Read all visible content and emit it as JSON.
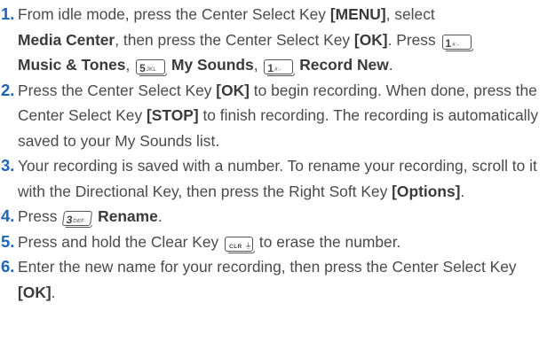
{
  "steps": [
    {
      "num": "1.",
      "t1": "From idle mode, press the Center Select Key ",
      "b1": "[MENU]",
      "t2": ", select ",
      "b2": "Media Center",
      "t3": ", then press the Center Select Key ",
      "b3": "[OK]",
      "t4": ". Press ",
      "key1": {
        "digit": "1",
        "letters": "#:-",
        "icon": "key-1-icon"
      },
      "b4": "Music & Tones",
      "t5": ", ",
      "key2": {
        "digit": "5",
        "letters": "JKL",
        "icon": "key-5-icon"
      },
      "b5": "My Sounds",
      "t6": ", ",
      "key3": {
        "digit": "1",
        "letters": "#:-",
        "icon": "key-1-icon"
      },
      "b6": "Record New",
      "t7": "."
    },
    {
      "num": "2.",
      "t1": "Press the Center Select Key ",
      "b1": "[OK]",
      "t2": " to begin recording. When done, press the Center Select Key ",
      "b2": "[STOP]",
      "t3": " to finish recording. The recording is automatically saved to your My Sounds list."
    },
    {
      "num": "3.",
      "t1": "Your recording is saved with a number. To rename your recording, scroll to it with the Directional Key, then press the Right Soft Key ",
      "b1": "[Options]",
      "t2": "."
    },
    {
      "num": "4.",
      "t1": "Press ",
      "key1": {
        "digit": "3",
        "letters": "DEF",
        "icon": "key-3-icon"
      },
      "b1": "Rename",
      "t2": "."
    },
    {
      "num": "5.",
      "t1": "Press and hold the Clear Key ",
      "key1": {
        "digit": "CLR",
        "letters": "⏚",
        "icon": "clear-key-icon"
      },
      "t2": " to erase the number."
    },
    {
      "num": "6.",
      "t1": "Enter the new name for your recording, then press the Center Select Key ",
      "b1": "[OK]",
      "t2": "."
    }
  ]
}
